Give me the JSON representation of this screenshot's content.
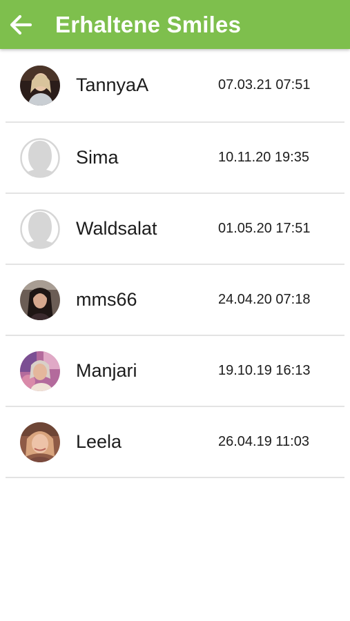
{
  "header": {
    "title": "Erhaltene Smiles",
    "background": "#7ebf4d",
    "back_icon": "arrow-left-icon"
  },
  "smiles": [
    {
      "name": "TannyaA",
      "date": "07.03.21 07:51",
      "avatar": "photo"
    },
    {
      "name": "Sima",
      "date": "10.11.20 19:35",
      "avatar": "placeholder"
    },
    {
      "name": "Waldsalat",
      "date": "01.05.20 17:51",
      "avatar": "placeholder"
    },
    {
      "name": "mms66",
      "date": "24.04.20 07:18",
      "avatar": "photo"
    },
    {
      "name": "Manjari",
      "date": "19.10.19 16:13",
      "avatar": "photo"
    },
    {
      "name": "Leela",
      "date": "26.04.19 11:03",
      "avatar": "photo"
    }
  ]
}
